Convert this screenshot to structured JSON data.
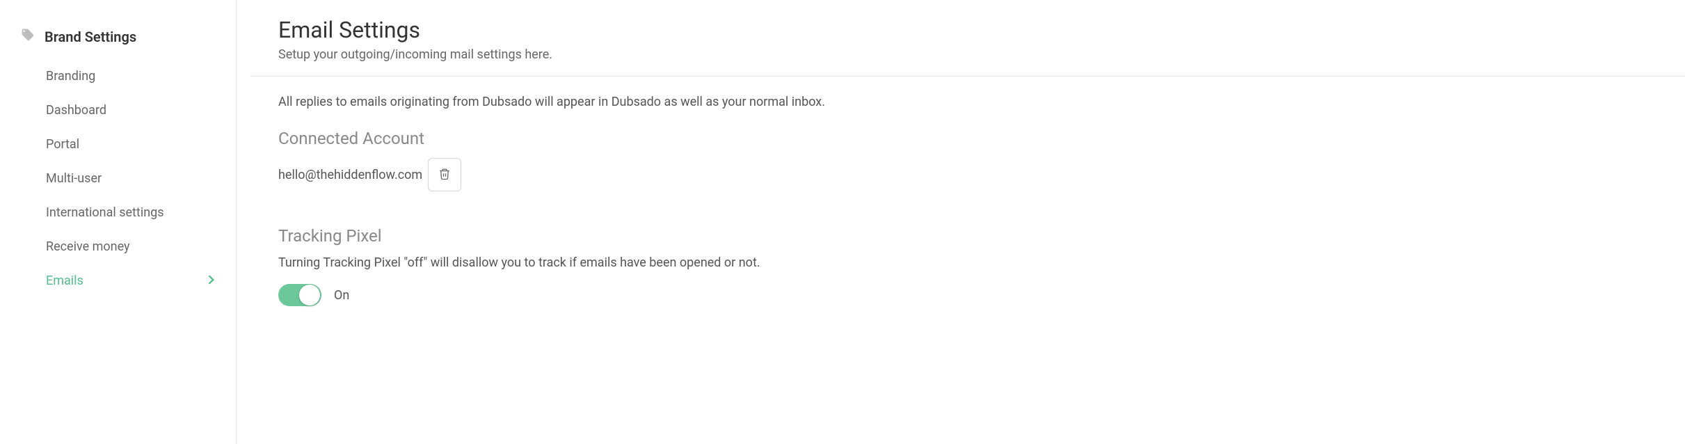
{
  "sidebar": {
    "header": "Brand Settings",
    "items": [
      {
        "label": "Branding",
        "active": false
      },
      {
        "label": "Dashboard",
        "active": false
      },
      {
        "label": "Portal",
        "active": false
      },
      {
        "label": "Multi-user",
        "active": false
      },
      {
        "label": "International settings",
        "active": false
      },
      {
        "label": "Receive money",
        "active": false
      },
      {
        "label": "Emails",
        "active": true
      }
    ]
  },
  "main": {
    "title": "Email Settings",
    "subtitle": "Setup your outgoing/incoming mail settings here.",
    "intro": "All replies to emails originating from Dubsado will appear in Dubsado as well as your normal inbox.",
    "connected_account": {
      "heading": "Connected Account",
      "email": "hello@thehiddenflow.com"
    },
    "tracking_pixel": {
      "heading": "Tracking Pixel",
      "description": "Turning Tracking Pixel \"off\" will disallow you to track if emails have been opened or not.",
      "state_label": "On",
      "enabled": true
    }
  }
}
